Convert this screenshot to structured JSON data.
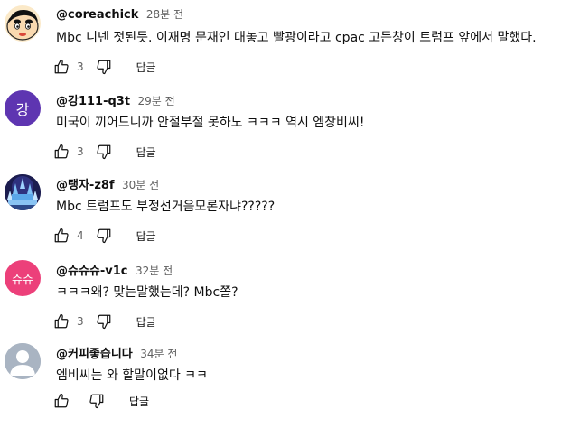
{
  "comments": [
    {
      "author": "@coreachick",
      "time": "28분 전",
      "text": "Mbc 니넨 젓된듯. 이재명 문재인 대놓고 빨광이라고 cpac 고든창이 트럼프 앞에서 말했다.",
      "likes": "3",
      "reply_label": "답글",
      "avatar": {
        "type": "cartoon",
        "icon": "cartoon-boy-avatar"
      }
    },
    {
      "author": "@강111-q3t",
      "time": "29분 전",
      "text": "미국이 끼어드니까 안절부절 못하노 ㅋㅋㅋ 역시 엠창비씨!",
      "likes": "3",
      "reply_label": "답글",
      "avatar": {
        "type": "letter",
        "letter": "강",
        "color": "#5e35b1"
      }
    },
    {
      "author": "@탱자-z8f",
      "time": "30분 전",
      "text": "Mbc 트럼프도 부정선거음모론자냐?????",
      "likes": "4",
      "reply_label": "답글",
      "avatar": {
        "type": "image",
        "icon": "crystal-castle-avatar"
      }
    },
    {
      "author": "@슈슈슈-v1c",
      "time": "32분 전",
      "text": "ㅋㅋㅋ왜? 맞는말했는데? Mbc쫄?",
      "likes": "3",
      "reply_label": "답글",
      "avatar": {
        "type": "letter",
        "letter": "슈슈",
        "color": "#ec407a"
      }
    },
    {
      "author": "@커피좋습니다",
      "time": "34분 전",
      "text": "엠비씨는 와 할말이없다 ㅋㅋ",
      "likes": "",
      "reply_label": "답글",
      "avatar": {
        "type": "default",
        "icon": "default-person-avatar"
      }
    }
  ]
}
